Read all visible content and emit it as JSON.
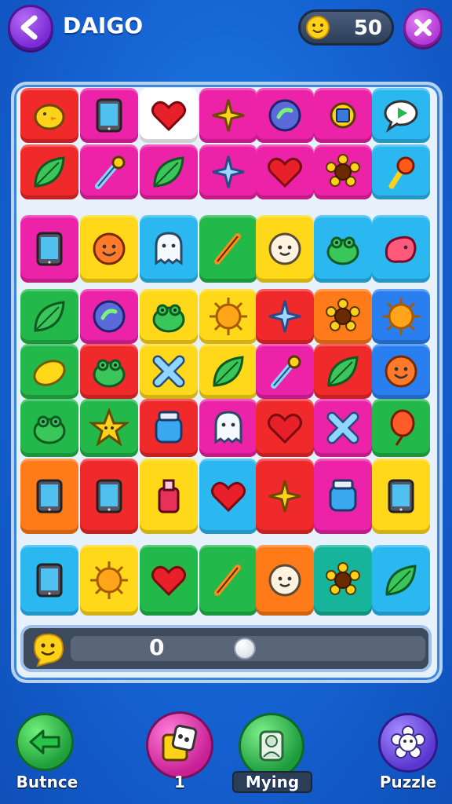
{
  "header": {
    "title": "DAIGO",
    "coins": "50",
    "back_icon": "arrow-left-icon",
    "close_icon": "close-icon",
    "coin_icon": "smiley-coin-icon"
  },
  "colors": {
    "red": "#f0292b",
    "magenta": "#ec22a8",
    "pink": "#ff3fb6",
    "cyan": "#2bb7ef",
    "yellow": "#ffd81a",
    "green": "#22b84a",
    "orange": "#ff7a18",
    "blue": "#2a7ff0",
    "teal": "#16b49a",
    "white": "#ffffff"
  },
  "board": {
    "tiles": [
      {
        "color": "red",
        "icon": "chick-icon"
      },
      {
        "color": "magenta",
        "icon": "tablet-icon"
      },
      {
        "color": "white",
        "icon": "heart-icon"
      },
      {
        "color": "magenta",
        "icon": "star-cross-icon"
      },
      {
        "color": "magenta",
        "icon": "gem-icon"
      },
      {
        "color": "magenta",
        "icon": "gear-icon"
      },
      {
        "color": "cyan",
        "icon": "chat-icon"
      },
      {
        "color": "red",
        "icon": "leaf-icon"
      },
      {
        "color": "magenta",
        "icon": "dropper-icon"
      },
      {
        "color": "magenta",
        "icon": "leaf-icon"
      },
      {
        "color": "magenta",
        "icon": "sparkle-icon"
      },
      {
        "color": "magenta",
        "icon": "heart-icon"
      },
      {
        "color": "magenta",
        "icon": "flower-icon"
      },
      {
        "color": "cyan",
        "icon": "torch-icon"
      },
      {
        "color": "magenta",
        "icon": "tablet-icon"
      },
      {
        "color": "yellow",
        "icon": "smiley-icon"
      },
      {
        "color": "cyan",
        "icon": "ghost-icon"
      },
      {
        "color": "green",
        "icon": "pen-icon"
      },
      {
        "color": "yellow",
        "icon": "face-icon"
      },
      {
        "color": "cyan",
        "icon": "frog-icon"
      },
      {
        "color": "cyan",
        "icon": "blob-icon"
      },
      {
        "color": "green",
        "icon": "leaf-icon"
      },
      {
        "color": "magenta",
        "icon": "gem-icon"
      },
      {
        "color": "yellow",
        "icon": "frog-icon"
      },
      {
        "color": "yellow",
        "icon": "sun-icon"
      },
      {
        "color": "red",
        "icon": "sparkle-icon"
      },
      {
        "color": "orange",
        "icon": "flower-icon"
      },
      {
        "color": "blue",
        "icon": "sun-icon"
      },
      {
        "color": "green",
        "icon": "lemon-icon"
      },
      {
        "color": "red",
        "icon": "frog-icon"
      },
      {
        "color": "yellow",
        "icon": "cross-icon"
      },
      {
        "color": "yellow",
        "icon": "leaf-icon"
      },
      {
        "color": "magenta",
        "icon": "dropper-icon"
      },
      {
        "color": "red",
        "icon": "leaf-icon"
      },
      {
        "color": "blue",
        "icon": "smiley-icon"
      },
      {
        "color": "green",
        "icon": "frog-icon"
      },
      {
        "color": "green",
        "icon": "star-icon"
      },
      {
        "color": "red",
        "icon": "jar-icon"
      },
      {
        "color": "magenta",
        "icon": "ghost-icon"
      },
      {
        "color": "red",
        "icon": "heart-icon"
      },
      {
        "color": "magenta",
        "icon": "cross-icon"
      },
      {
        "color": "green",
        "icon": "balloon-icon"
      },
      {
        "color": "orange",
        "icon": "tablet-icon"
      },
      {
        "color": "red",
        "icon": "tablet-icon"
      },
      {
        "color": "yellow",
        "icon": "bottle-icon"
      },
      {
        "color": "cyan",
        "icon": "heart-icon"
      },
      {
        "color": "red",
        "icon": "star-cross-icon"
      },
      {
        "color": "magenta",
        "icon": "jar-icon"
      },
      {
        "color": "yellow",
        "icon": "tablet-icon"
      },
      {
        "color": "cyan",
        "icon": "tablet-icon"
      },
      {
        "color": "yellow",
        "icon": "sun-icon"
      },
      {
        "color": "green",
        "icon": "heart-icon"
      },
      {
        "color": "green",
        "icon": "pen-icon"
      },
      {
        "color": "orange",
        "icon": "face-icon"
      },
      {
        "color": "teal",
        "icon": "flower-icon"
      },
      {
        "color": "cyan",
        "icon": "leaf-icon"
      }
    ]
  },
  "progress": {
    "value": "0",
    "fraction": 0.5,
    "icon": "smiley-coin-icon"
  },
  "nav": [
    {
      "label": "Butnce",
      "icon": "arrow-left-icon",
      "color": "#27c44a"
    },
    {
      "label": "1",
      "icon": "dice-icon",
      "color": "#e52ab0"
    },
    {
      "label": "Mying",
      "icon": "character-icon",
      "color": "#22b84a"
    },
    {
      "label": "Puzzle",
      "icon": "flower-icon",
      "color": "#6a4ae0"
    }
  ]
}
